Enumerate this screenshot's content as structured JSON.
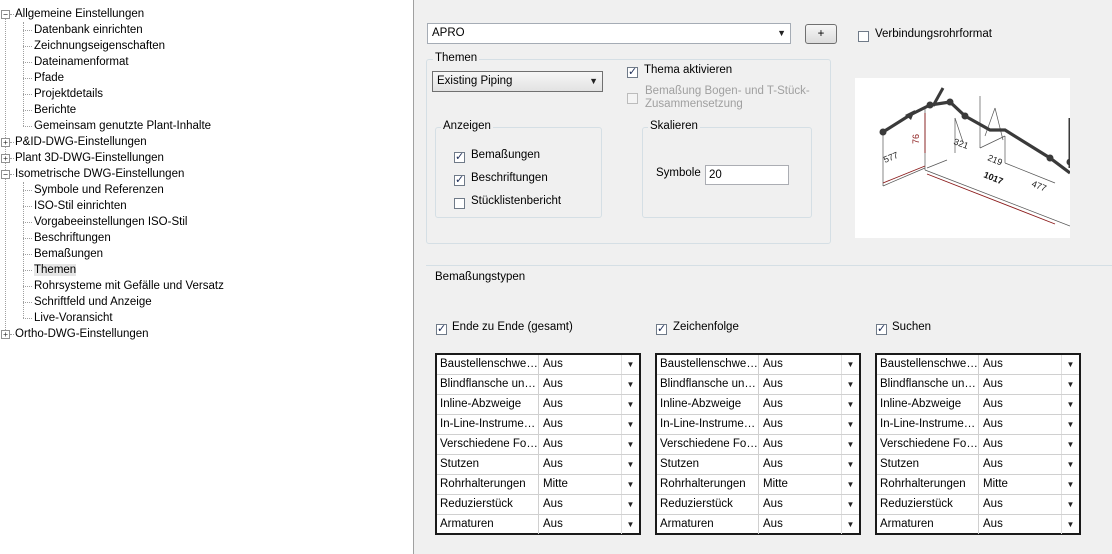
{
  "tree": {
    "items": [
      {
        "label": "Allgemeine Einstellungen",
        "level": 0,
        "expander": "−"
      },
      {
        "label": "Datenbank einrichten",
        "level": 1
      },
      {
        "label": "Zeichnungseigenschaften",
        "level": 1
      },
      {
        "label": "Dateinamenformat",
        "level": 1
      },
      {
        "label": "Pfade",
        "level": 1
      },
      {
        "label": "Projektdetails",
        "level": 1
      },
      {
        "label": "Berichte",
        "level": 1
      },
      {
        "label": "Gemeinsam genutzte Plant-Inhalte",
        "level": 1
      },
      {
        "label": "P&ID-DWG-Einstellungen",
        "level": 0,
        "expander": "+"
      },
      {
        "label": "Plant 3D-DWG-Einstellungen",
        "level": 0,
        "expander": "+"
      },
      {
        "label": "Isometrische DWG-Einstellungen",
        "level": 0,
        "expander": "−"
      },
      {
        "label": "Symbole und Referenzen",
        "level": 1
      },
      {
        "label": "ISO-Stil einrichten",
        "level": 1
      },
      {
        "label": "Vorgabeeinstellungen ISO-Stil",
        "level": 1
      },
      {
        "label": "Beschriftungen",
        "level": 1
      },
      {
        "label": "Bemaßungen",
        "level": 1
      },
      {
        "label": "Themen",
        "level": 1,
        "selected": true
      },
      {
        "label": "Rohrsysteme mit Gefälle und Versatz",
        "level": 1
      },
      {
        "label": "Schriftfeld und Anzeige",
        "level": 1
      },
      {
        "label": "Live-Voransicht",
        "level": 1
      },
      {
        "label": "Ortho-DWG-Einstellungen",
        "level": 0,
        "expander": "+"
      }
    ]
  },
  "style_combo": {
    "value": "APRO"
  },
  "add_button": {
    "label": "+"
  },
  "verbindungsrohr": {
    "label": "Verbindungsrohrformat",
    "checked": false
  },
  "themen": {
    "title": "Themen",
    "combo_value": "Existing Piping",
    "aktivieren_label": "Thema aktivieren",
    "bogen_label_1": "Bemaßung Bogen- und T-Stück-",
    "bogen_label_2": "Zusammensetzung"
  },
  "anzeigen": {
    "title": "Anzeigen",
    "bemassungen": "Bemaßungen",
    "beschriftungen": "Beschriftungen",
    "stueckliste": "Stücklistenbericht"
  },
  "skalieren": {
    "title": "Skalieren",
    "symbole_label": "Symbole",
    "symbole_value": "20"
  },
  "preview": {
    "dims": [
      "76",
      "321",
      "577",
      "219",
      "1017",
      "477"
    ]
  },
  "bemassungstypen": {
    "title": "Bemaßungstypen",
    "columns": [
      {
        "label": "Ende zu Ende (gesamt)",
        "checked": true
      },
      {
        "label": "Zeichenfolge",
        "checked": true
      },
      {
        "label": "Suchen",
        "checked": true
      }
    ],
    "rows": [
      {
        "name": "Baustellenschwei...",
        "value": "Aus"
      },
      {
        "name": "Blindflansche und...",
        "value": "Aus"
      },
      {
        "name": "Inline-Abzweige",
        "value": "Aus"
      },
      {
        "name": "In-Line-Instrumente",
        "value": "Aus"
      },
      {
        "name": "Verschiedene For...",
        "value": "Aus"
      },
      {
        "name": "Stutzen",
        "value": "Aus"
      },
      {
        "name": "Rohrhalterungen",
        "value": "Mitte"
      },
      {
        "name": "Reduzierstück",
        "value": "Aus"
      },
      {
        "name": "Armaturen",
        "value": "Aus"
      }
    ]
  }
}
